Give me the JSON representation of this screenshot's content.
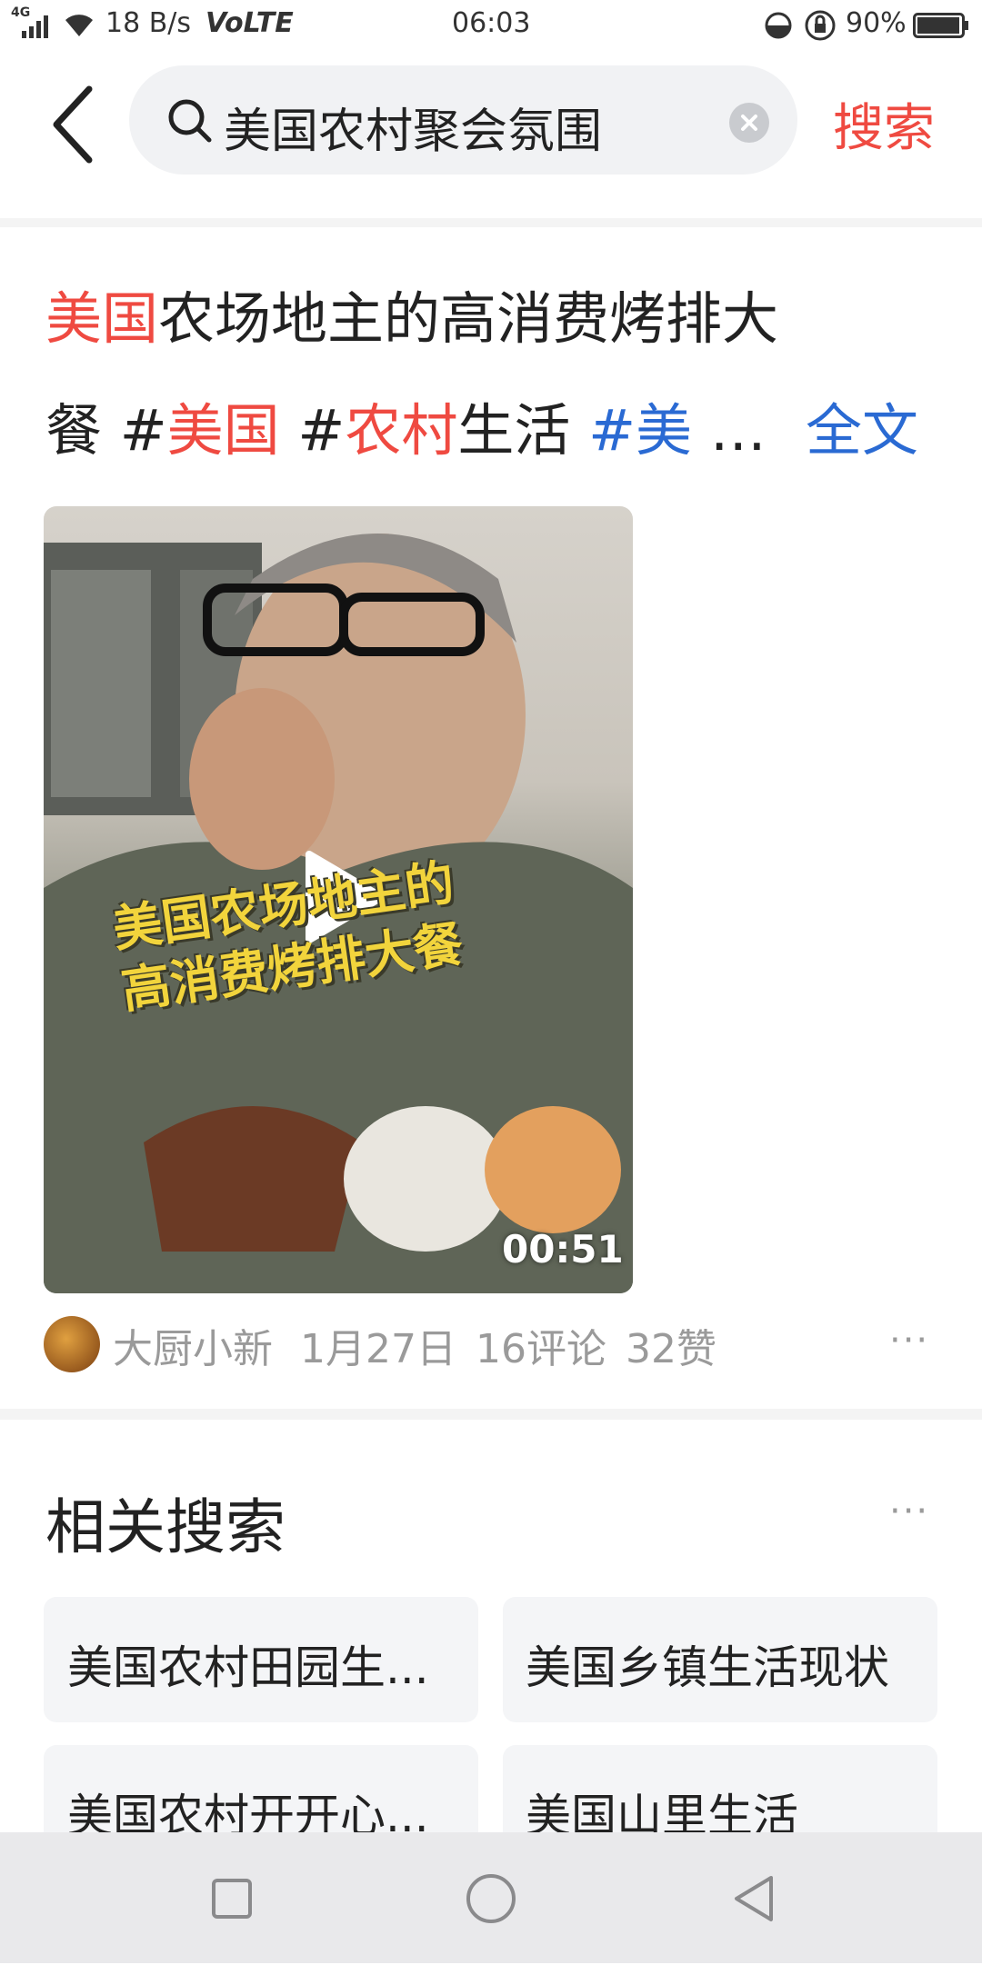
{
  "status_bar": {
    "network": "4G",
    "speed": "18 B/s",
    "volte": "VoLTE",
    "time": "06:03",
    "battery": "90%",
    "icons": [
      "signal-icon",
      "wifi-icon",
      "moon-icon",
      "lock-rotation-icon",
      "battery-icon"
    ]
  },
  "search": {
    "query": "美国农村聚会氛围",
    "button_label": "搜索"
  },
  "post": {
    "title_line1_red": "美国",
    "title_line1_rest": "农场地主的高消费烤排大",
    "title_line2_a": "餐 #",
    "title_line2_b": "美国",
    "title_line2_c": " #",
    "title_line2_d": "农村",
    "title_line2_e": "生活 ",
    "title_line2_f": "#美",
    "title_line2_g": " …",
    "full_text_link": "全文",
    "video_overlay_line1": "美国农场地主的",
    "video_overlay_line2": "高消费烤排大餐",
    "duration": "00:51",
    "author": "大厨小新",
    "date": "1月27日",
    "comments": "16评论",
    "likes": "32赞",
    "more": "···"
  },
  "related": {
    "title": "相关搜索",
    "more": "···",
    "items": [
      "美国农村田园生...",
      "美国乡镇生活现状",
      "美国农村开开心...",
      "美国山里生活"
    ]
  },
  "colors": {
    "accent_red": "#ef4a41",
    "link_blue": "#2a6ad3",
    "overlay_yellow": "#f2d43c"
  }
}
